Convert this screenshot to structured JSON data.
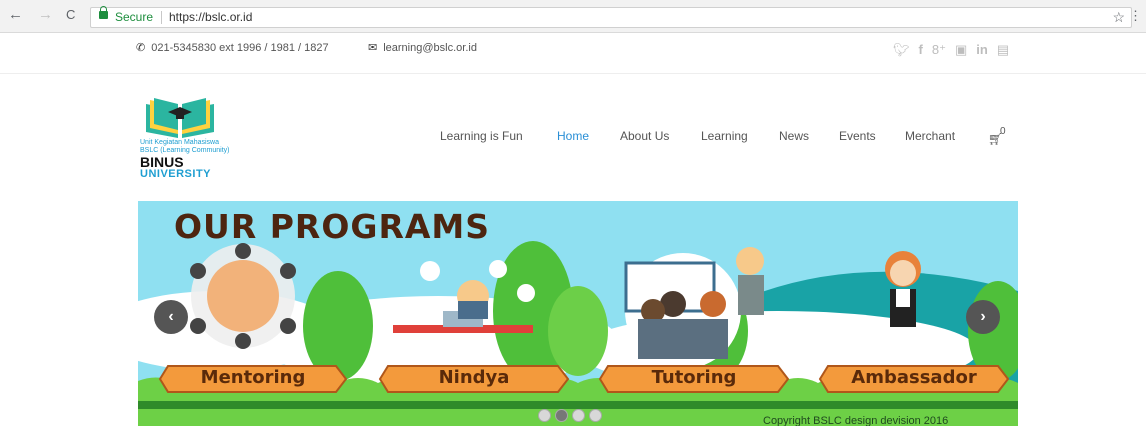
{
  "browser": {
    "secure_label": "Secure",
    "url": "https://bslc.or.id",
    "back_icon": "←",
    "forward_icon": "→",
    "reload_icon": "C",
    "star_icon": "☆",
    "menu_icon": "⋮"
  },
  "topbar": {
    "phone": "021-5345830 ext 1996 / 1981 / 1827",
    "email": "learning@bslc.or.id",
    "social": [
      "twitter-icon",
      "facebook-icon",
      "google-plus-icon",
      "instagram-icon",
      "linkedin-icon",
      "youtube-icon"
    ]
  },
  "logo": {
    "line1": "Unit Kegiatan Mahasiswa",
    "line2": "BSLC (Learning Community)",
    "line3": "BINUS",
    "line4": "UNIVERSITY"
  },
  "nav": {
    "items": [
      {
        "label": "Learning is Fun"
      },
      {
        "label": "Home"
      },
      {
        "label": "About Us"
      },
      {
        "label": "Learning"
      },
      {
        "label": "News"
      },
      {
        "label": "Events"
      },
      {
        "label": "Merchant"
      }
    ],
    "active": "Home",
    "cart_count": "0"
  },
  "slider": {
    "title": "OUR PROGRAMS",
    "programs": [
      "Mentoring",
      "Nindya",
      "Tutoring",
      "Ambassador"
    ],
    "prev_icon": "‹",
    "next_icon": "›",
    "copyright": "Copyright BSLC design devision 2016",
    "active_slide": 2,
    "slide_count": 4
  },
  "colors": {
    "accent": "#2a8fd6",
    "sky": "#8fe0f1",
    "grass": "#5cc33b",
    "banner": "#f39a3c"
  }
}
